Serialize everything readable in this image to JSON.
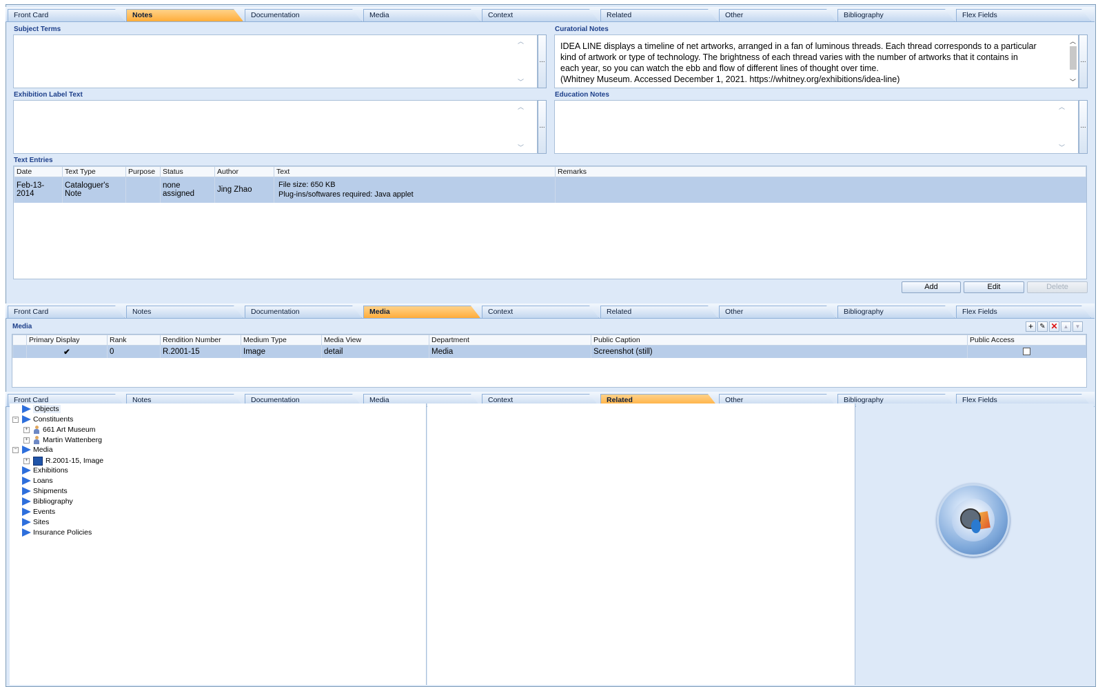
{
  "tabs": [
    "Front Card",
    "Notes",
    "Documentation",
    "Media",
    "Context",
    "Related",
    "Other",
    "Bibliography",
    "Flex Fields"
  ],
  "notes_panel": {
    "subject_terms_label": "Subject Terms",
    "curatorial_notes_label": "Curatorial Notes",
    "curatorial_notes_lines": [
      "IDEA LINE displays a timeline of net artworks, arranged in a fan of luminous threads. Each thread corresponds to a particular",
      "kind of artwork or type of technology. The brightness of each thread varies with the number of artworks that it contains in",
      "each year, so you can watch the ebb and flow of different lines of thought over time.",
      "(Whitney Museum. Accessed December 1, 2021. https://whitney.org/exhibitions/idea-line)"
    ],
    "exhibition_label_text_label": "Exhibition Label Text",
    "education_notes_label": "Education Notes",
    "ellipsis": "...",
    "text_entries_label": "Text Entries",
    "text_entries_columns": [
      "Date",
      "Text Type",
      "Purpose",
      "Status",
      "Author",
      "Text",
      "Remarks"
    ],
    "text_entries_rows": [
      {
        "date": "Feb-13-2014",
        "text_type": "Cataloguer's Note",
        "purpose": "",
        "status": "none assigned",
        "author": "Jing Zhao",
        "text_line1": "File size: 650 KB",
        "text_line2": "Plug-ins/softwares required: Java applet",
        "remarks": ""
      }
    ],
    "buttons": {
      "add": "Add",
      "edit": "Edit",
      "delete": "Delete"
    }
  },
  "media_panel": {
    "label": "Media",
    "columns": [
      "Primary Display",
      "Rank",
      "Rendition Number",
      "Medium Type",
      "Media View",
      "Department",
      "Public Caption",
      "Public Access"
    ],
    "rows": [
      {
        "primary_display": "✔",
        "rank": "0",
        "rendition_number": "R.2001-15",
        "medium_type": "Image",
        "media_view": "detail",
        "department": "Media",
        "public_caption": "Screenshot (still)",
        "public_access": ""
      }
    ],
    "toolbar_glyphs": {
      "add": "+",
      "edit": "✎",
      "delete": "✕",
      "up": "▲",
      "down": "▼"
    }
  },
  "related_panel": {
    "tree": [
      {
        "label": "Objects",
        "level": 0,
        "expander": "",
        "icon": "flag-icon",
        "selected": true
      },
      {
        "label": "Constituents",
        "level": 0,
        "expander": "−",
        "icon": "flag-icon"
      },
      {
        "label": "661 Art Museum",
        "level": 1,
        "expander": "+",
        "icon": "person-icon"
      },
      {
        "label": "Martin Wattenberg",
        "level": 1,
        "expander": "+",
        "icon": "person-icon"
      },
      {
        "label": "Media",
        "level": 0,
        "expander": "−",
        "icon": "flag-icon"
      },
      {
        "label": "R.2001-15, Image",
        "level": 1,
        "expander": "+",
        "icon": "image-icon"
      },
      {
        "label": "Exhibitions",
        "level": 0,
        "expander": "",
        "icon": "flag-icon"
      },
      {
        "label": "Loans",
        "level": 0,
        "expander": "",
        "icon": "flag-icon"
      },
      {
        "label": "Shipments",
        "level": 0,
        "expander": "",
        "icon": "flag-icon"
      },
      {
        "label": "Bibliography",
        "level": 0,
        "expander": "",
        "icon": "flag-icon"
      },
      {
        "label": "Events",
        "level": 0,
        "expander": "",
        "icon": "flag-icon"
      },
      {
        "label": "Sites",
        "level": 0,
        "expander": "",
        "icon": "flag-icon"
      },
      {
        "label": "Insurance Policies",
        "level": 0,
        "expander": "",
        "icon": "flag-icon"
      }
    ]
  },
  "colors": {
    "active_tab": "#ffad3a",
    "panel_bg": "#dde9f8",
    "label_blue": "#1d3f8a",
    "selected_row": "#b8cde9"
  }
}
